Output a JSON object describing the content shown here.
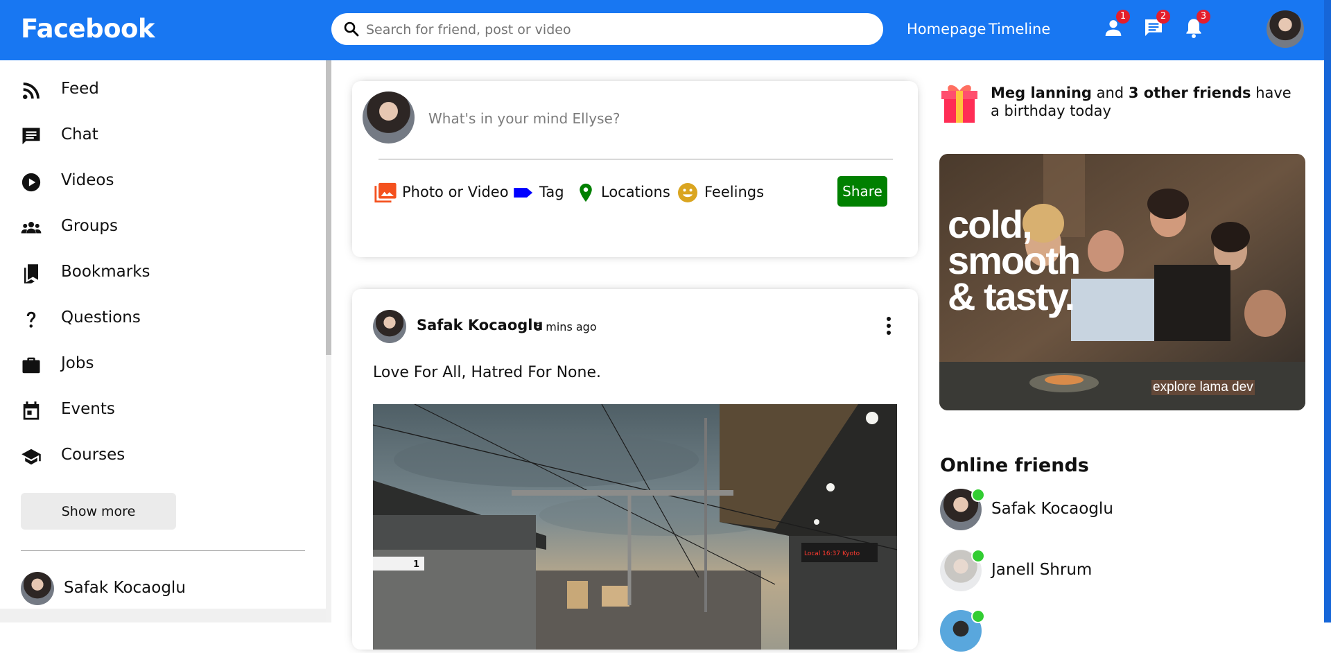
{
  "topbar": {
    "logo": "Facebook",
    "search_placeholder": "Search for friend, post or video",
    "links": [
      "Homepage",
      "Timeline"
    ],
    "badges": {
      "friends": "1",
      "messages": "2",
      "notifications": "3"
    }
  },
  "sidebar": {
    "items": [
      {
        "label": "Feed",
        "icon": "rss-feed-icon"
      },
      {
        "label": "Chat",
        "icon": "chat-icon"
      },
      {
        "label": "Videos",
        "icon": "play-circle-icon"
      },
      {
        "label": "Groups",
        "icon": "groups-icon"
      },
      {
        "label": "Bookmarks",
        "icon": "bookmarks-icon"
      },
      {
        "label": "Questions",
        "icon": "help-question-icon"
      },
      {
        "label": "Jobs",
        "icon": "work-briefcase-icon"
      },
      {
        "label": "Events",
        "icon": "event-calendar-icon"
      },
      {
        "label": "Courses",
        "icon": "school-cap-icon"
      }
    ],
    "show_more": "Show more",
    "friend": "Safak Kocaoglu"
  },
  "share": {
    "placeholder": "What's in your mind Ellyse?",
    "options": [
      {
        "label": "Photo or Video",
        "color": "#f4511e"
      },
      {
        "label": "Tag",
        "color": "#0000ff"
      },
      {
        "label": "Locations",
        "color": "#008000"
      },
      {
        "label": "Feelings",
        "color": "#daa520"
      }
    ],
    "button": "Share"
  },
  "post": {
    "author": "Safak Kocaoglu",
    "time": "5 mins ago",
    "text": "Love For All, Hatred For None.",
    "image_sign_left": "1",
    "image_sign_right": "Local 16:37 Kyoto"
  },
  "rightbar": {
    "birthday": {
      "name": "Meg lanning",
      "connector": "and",
      "others": "3 other friends",
      "suffix": "have a birthday today"
    },
    "ad": {
      "headline_lines": [
        "cold,",
        "smooth",
        "& tasty."
      ],
      "tagline": "explore lama dev"
    },
    "online_title": "Online friends",
    "online_friends": [
      "Safak Kocaoglu",
      "Janell Shrum",
      ""
    ]
  },
  "colors": {
    "brand": "#1877f2",
    "badge": "#e41e2b",
    "online": "#32cd32",
    "share_button": "#008000"
  }
}
